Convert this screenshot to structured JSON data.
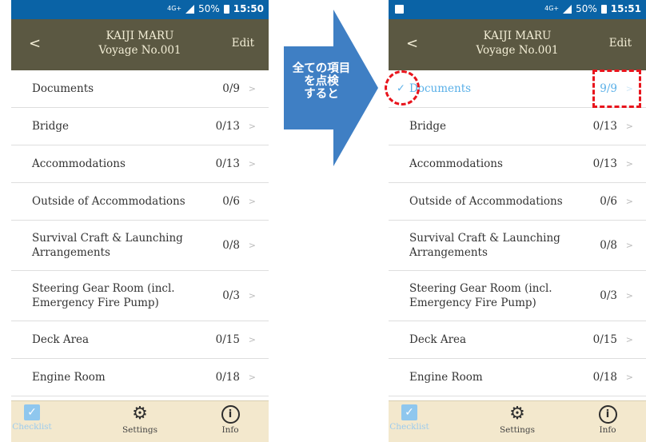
{
  "status_left": {
    "network": "4G+",
    "battery": "50%",
    "time": "15:50"
  },
  "status_right": {
    "network": "4G+",
    "battery": "50%",
    "time": "15:51"
  },
  "header": {
    "back": "<",
    "title_line1": "KAIJI MARU",
    "title_line2": "Voyage No.001",
    "edit": "Edit"
  },
  "left_items": [
    {
      "label": "Documents",
      "count": "0/9"
    },
    {
      "label": "Bridge",
      "count": "0/13"
    },
    {
      "label": "Accommodations",
      "count": "0/13"
    },
    {
      "label": "Outside of Accommodations",
      "count": "0/6"
    },
    {
      "label": "Survival Craft & Launching Arrangements",
      "count": "0/8"
    },
    {
      "label": "Steering Gear Room (incl. Emergency Fire Pump)",
      "count": "0/3"
    },
    {
      "label": "Deck Area",
      "count": "0/15"
    },
    {
      "label": "Engine Room",
      "count": "0/18"
    }
  ],
  "right_items": [
    {
      "label": "Documents",
      "count": "9/9"
    },
    {
      "label": "Bridge",
      "count": "0/13"
    },
    {
      "label": "Accommodations",
      "count": "0/13"
    },
    {
      "label": "Outside of Accommodations",
      "count": "0/6"
    },
    {
      "label": "Survival Craft & Launching Arrangements",
      "count": "0/8"
    },
    {
      "label": "Steering Gear Room (incl. Emergency Fire Pump)",
      "count": "0/3"
    },
    {
      "label": "Deck Area",
      "count": "0/15"
    },
    {
      "label": "Engine Room",
      "count": "0/18"
    }
  ],
  "chevron": ">",
  "check_mark": "✓",
  "tabs": {
    "checklist": "Checklist",
    "settings": "Settings",
    "info": "Info"
  },
  "callout": {
    "line1": "全ての項目",
    "line2": "を点検",
    "line3": "すると"
  },
  "colors": {
    "nav": "#5b5842",
    "status_bar": "#0a63a6",
    "tab_bar": "#f3e8cd",
    "accent": "#5ab0e8",
    "arrow": "#3f7fc4",
    "highlight": "#e8141c"
  }
}
